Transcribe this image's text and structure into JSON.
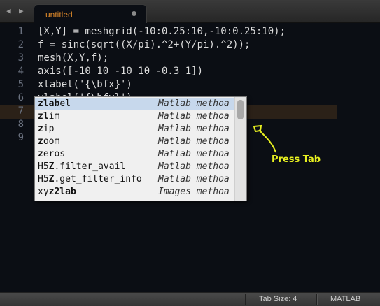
{
  "tabbar": {
    "back_icon": "◀",
    "forward_icon": "▶",
    "tab_title": "untitled"
  },
  "editor": {
    "line_numbers": [
      "1",
      "2",
      "3",
      "4",
      "5",
      "6",
      "7",
      "8",
      "9"
    ],
    "lines": [
      "[X,Y] = meshgrid(-10:0.25:10,-10:0.25:10);",
      "f = sinc(sqrt((X/pi).^2+(Y/pi).^2));",
      "mesh(X,Y,f);",
      "axis([-10 10 -10 10 -0.3 1])",
      "xlabel('{\\bfx}')",
      "ylabel('{\\bfy}')",
      "zlab"
    ]
  },
  "autocomplete": {
    "items": [
      {
        "prefix": "",
        "bold": "zlab",
        "rest": "el",
        "type": "Matlab methoa",
        "selected": true
      },
      {
        "prefix": "",
        "bold": "zl",
        "rest": "im",
        "type": "Matlab methoa",
        "selected": false
      },
      {
        "prefix": "",
        "bold": "z",
        "rest": "ip",
        "type": "Matlab methoa",
        "selected": false
      },
      {
        "prefix": "",
        "bold": "z",
        "rest": "oom",
        "type": "Matlab methoa",
        "selected": false
      },
      {
        "prefix": "",
        "bold": "z",
        "rest": "eros",
        "type": "Matlab methoa",
        "selected": false
      },
      {
        "prefix": "H5",
        "bold": "Z",
        "rest": ".filter_avail",
        "type": "Matlab methoa",
        "selected": false
      },
      {
        "prefix": "H5",
        "bold": "Z",
        "rest": ".get_filter_info",
        "type": "Matlab methoa",
        "selected": false
      },
      {
        "prefix": "xy",
        "bold": "z2lab",
        "rest": "",
        "type": "Images methoa",
        "selected": false
      }
    ]
  },
  "annotation": {
    "text": "Press Tab",
    "color": "#e8f020"
  },
  "statusbar": {
    "tab_size": "Tab Size: 4",
    "syntax": "MATLAB"
  }
}
